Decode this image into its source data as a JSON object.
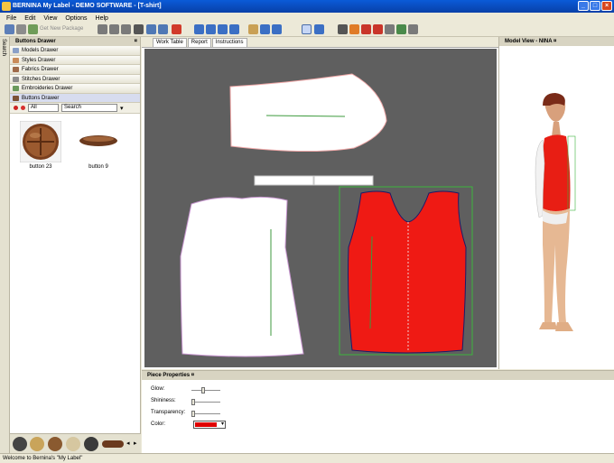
{
  "window": {
    "title": "BERNINA My Label - DEMO SOFTWARE - [T-shirt]"
  },
  "menu": [
    "File",
    "Edit",
    "View",
    "Options",
    "Help"
  ],
  "toolbar": {
    "get_new_package": "Get New Package"
  },
  "side_tab": "Search",
  "left_panel": {
    "title": "Buttons Drawer",
    "drawers": [
      {
        "label": "Models Drawer",
        "icon": "models-icon",
        "color": "#8aa0c8"
      },
      {
        "label": "Styles Drawer",
        "icon": "styles-icon",
        "color": "#c98b5a"
      },
      {
        "label": "Fabrics Drawer",
        "icon": "fabrics-icon",
        "color": "#9f6a4a"
      },
      {
        "label": "Stitches Drawer",
        "icon": "stitches-icon",
        "color": "#8c8c8c"
      },
      {
        "label": "Embroideries Drawer",
        "icon": "embroideries-icon",
        "color": "#6a9a5c"
      },
      {
        "label": "Buttons Drawer",
        "icon": "buttons-icon",
        "color": "#7b5236"
      }
    ],
    "filter_value": "All",
    "search_value": "Search",
    "items": [
      {
        "label": "button 23"
      },
      {
        "label": "button 9"
      }
    ]
  },
  "center": {
    "tabs": [
      "Work Table",
      "Report",
      "Instructions"
    ],
    "active_tab": "Work Table"
  },
  "model_view": {
    "title": "Model View - NINA"
  },
  "piece_properties": {
    "title": "Piece Properties",
    "glow_label": "Glow:",
    "shininess_label": "Shininess:",
    "transparency_label": "Transparency:",
    "color_label": "Color:",
    "glow_value": 0.4,
    "shininess_value": 0.0,
    "transparency_value": 0.0,
    "color": "#e00000"
  },
  "colors": {
    "piece_red": "#ef1a14",
    "canvas": "#5f5f5f",
    "accent": "#0a5bd8"
  },
  "status": "Welcome to Bernina's \"My Label\""
}
